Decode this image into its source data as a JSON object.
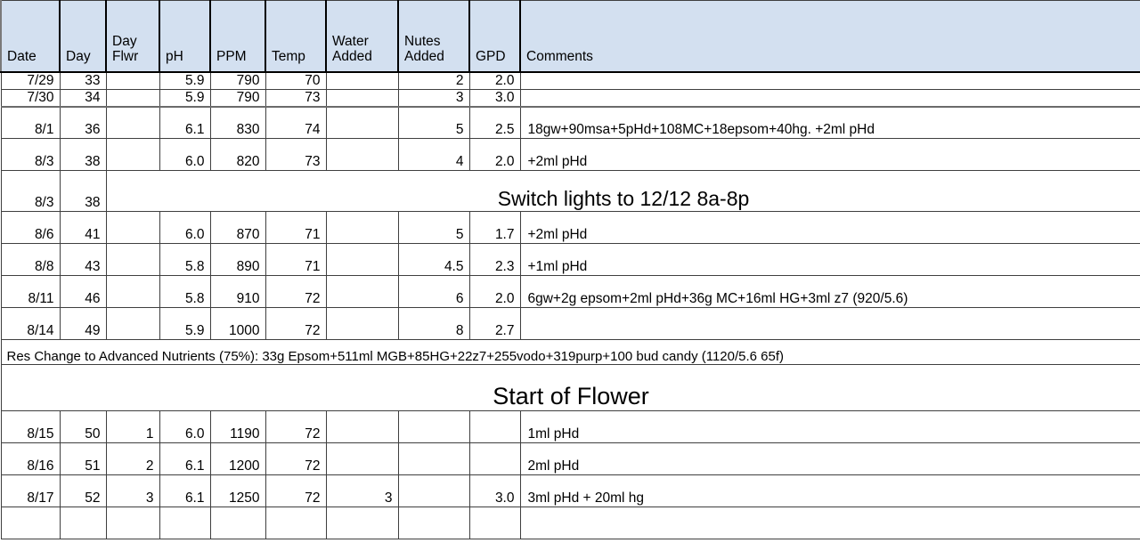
{
  "sheet": {
    "colors": {
      "header_fill": "#d3e0f0",
      "gpd_fill": "#fcebcd",
      "grid_line": "#3f3f3f",
      "banner_border": "#000000"
    },
    "columns": [
      {
        "key": "date",
        "label": "Date",
        "label2": ""
      },
      {
        "key": "day",
        "label": "Day",
        "label2": ""
      },
      {
        "key": "dayflwr",
        "label": "Day",
        "label2": "Flwr"
      },
      {
        "key": "ph",
        "label": "pH",
        "label2": ""
      },
      {
        "key": "ppm",
        "label": "PPM",
        "label2": ""
      },
      {
        "key": "temp",
        "label": "Temp",
        "label2": ""
      },
      {
        "key": "water",
        "label": "Water",
        "label2": "Added"
      },
      {
        "key": "nutes",
        "label": "Nutes",
        "label2": "Added"
      },
      {
        "key": "gpd",
        "label": "GPD",
        "label2": ""
      },
      {
        "key": "comments",
        "label": "Comments",
        "label2": ""
      }
    ],
    "rows": [
      {
        "type": "data",
        "compact": true,
        "date": "7/29",
        "day": "33",
        "dayflwr": "",
        "ph": "5.9",
        "ppm": "790",
        "temp": "70",
        "water": "",
        "nutes": "2",
        "gpd": "2.0",
        "comments": ""
      },
      {
        "type": "data",
        "compact": true,
        "date": "7/30",
        "day": "34",
        "dayflwr": "",
        "ph": "5.9",
        "ppm": "790",
        "temp": "73",
        "water": "",
        "nutes": "3",
        "gpd": "3.0",
        "comments": ""
      },
      {
        "type": "data",
        "compact": false,
        "date": "8/1",
        "day": "36",
        "dayflwr": "",
        "ph": "6.1",
        "ppm": "830",
        "temp": "74",
        "water": "",
        "nutes": "5",
        "gpd": "2.5",
        "comments": "18gw+90msa+5pHd+108MC+18epsom+40hg.    +2ml pHd"
      },
      {
        "type": "data",
        "compact": false,
        "date": "8/3",
        "day": "38",
        "dayflwr": "",
        "ph": "6.0",
        "ppm": "820",
        "temp": "73",
        "water": "",
        "nutes": "4",
        "gpd": "2.0",
        "comments": "+2ml pHd"
      },
      {
        "type": "banner_with_side",
        "date": "8/3",
        "day": "38",
        "banner_text": "Switch lights to 12/12 8a-8p"
      },
      {
        "type": "data",
        "compact": false,
        "date": "8/6",
        "day": "41",
        "dayflwr": "",
        "ph": "6.0",
        "ppm": "870",
        "temp": "71",
        "water": "",
        "nutes": "5",
        "gpd": "1.7",
        "comments": "+2ml pHd"
      },
      {
        "type": "data",
        "compact": false,
        "date": "8/8",
        "day": "43",
        "dayflwr": "",
        "ph": "5.8",
        "ppm": "890",
        "temp": "71",
        "water": "",
        "nutes": "4.5",
        "gpd": "2.3",
        "comments": "+1ml pHd"
      },
      {
        "type": "data",
        "compact": false,
        "date": "8/11",
        "day": "46",
        "dayflwr": "",
        "ph": "5.8",
        "ppm": "910",
        "temp": "72",
        "water": "",
        "nutes": "6",
        "gpd": "2.0",
        "comments": "6gw+2g epsom+2ml pHd+36g MC+16ml HG+3ml z7 (920/5.6)"
      },
      {
        "type": "data",
        "compact": false,
        "date": "8/14",
        "day": "49",
        "dayflwr": "",
        "ph": "5.9",
        "ppm": "1000",
        "temp": "72",
        "water": "",
        "nutes": "8",
        "gpd": "2.7",
        "comments": ""
      },
      {
        "type": "note",
        "note_text": "Res Change to Advanced Nutrients (75%): 33g Epsom+511ml MGB+85HG+22z7+255vodo+319purp+100  bud candy (1120/5.6 65f)"
      },
      {
        "type": "banner_full",
        "banner_text": "Start of Flower"
      },
      {
        "type": "data",
        "compact": false,
        "date": "8/15",
        "day": "50",
        "dayflwr": "1",
        "ph": "6.0",
        "ppm": "1190",
        "temp": "72",
        "water": "",
        "nutes": "",
        "gpd": "",
        "comments": "1ml pHd"
      },
      {
        "type": "data",
        "compact": false,
        "date": "8/16",
        "day": "51",
        "dayflwr": "2",
        "ph": "6.1",
        "ppm": "1200",
        "temp": "72",
        "water": "",
        "nutes": "",
        "gpd": "",
        "comments": "2ml pHd"
      },
      {
        "type": "data",
        "compact": false,
        "date": "8/17",
        "day": "52",
        "dayflwr": "3",
        "ph": "6.1",
        "ppm": "1250",
        "temp": "72",
        "water": "3",
        "nutes": "",
        "gpd": "3.0",
        "comments": "3ml pHd + 20ml hg"
      },
      {
        "type": "data",
        "compact": false,
        "partial": true,
        "date": "",
        "day": "",
        "dayflwr": "",
        "ph": "",
        "ppm": "",
        "temp": "",
        "water": "",
        "nutes": "",
        "gpd": "",
        "comments": ""
      }
    ]
  }
}
